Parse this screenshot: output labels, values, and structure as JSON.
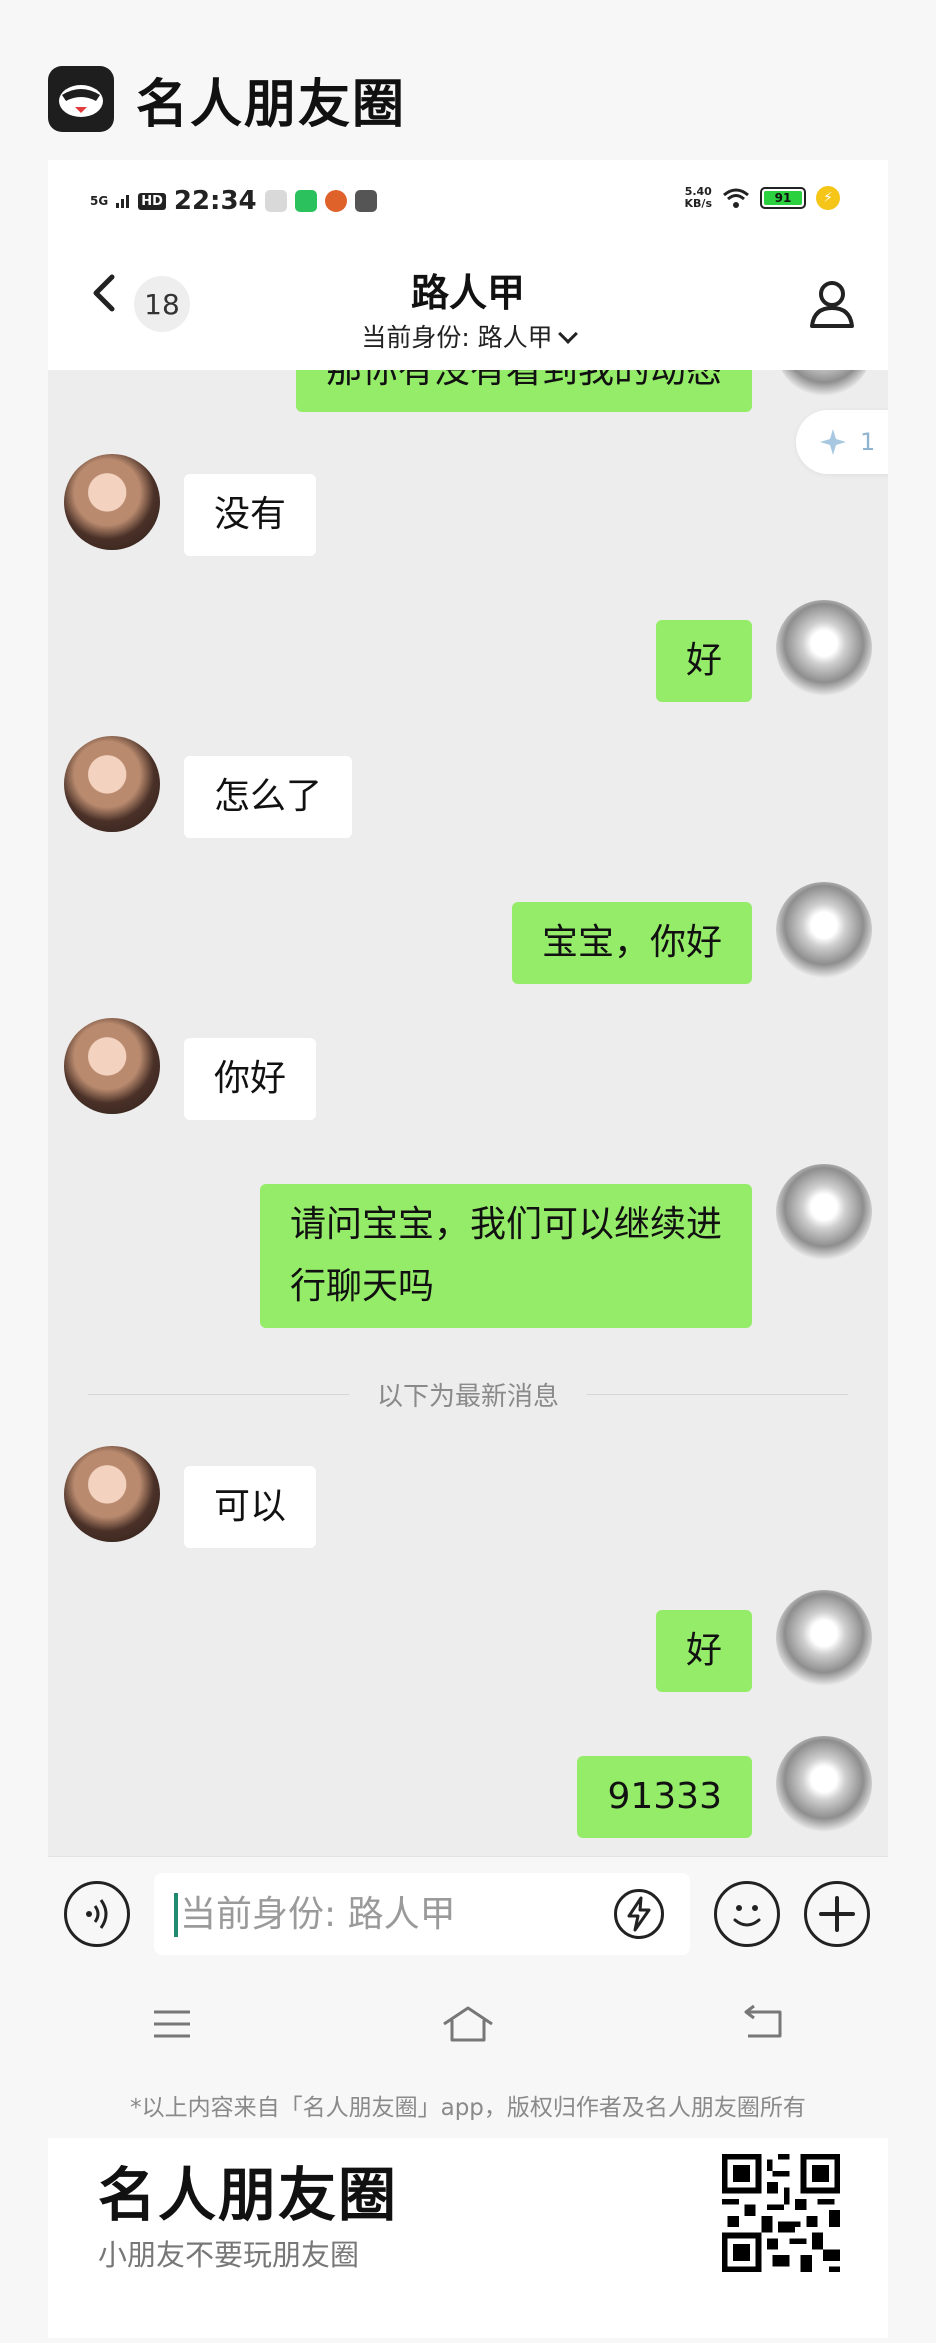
{
  "brand": {
    "title": "名人朋友圈"
  },
  "status_bar": {
    "network": "5G",
    "hd": "HD",
    "time": "22:34",
    "speed_top": "5.40",
    "speed_unit": "KB/s",
    "battery": "91"
  },
  "header": {
    "unread_count": "18",
    "title": "路人甲",
    "identity": "当前身份: 路人甲"
  },
  "float_badge": {
    "count": "1"
  },
  "messages": [
    {
      "side": "right",
      "text": "那你有没有看到我的动态"
    },
    {
      "side": "left",
      "text": "没有"
    },
    {
      "side": "right",
      "text": "好"
    },
    {
      "side": "left",
      "text": "怎么了"
    },
    {
      "side": "right",
      "text": "宝宝，你好"
    },
    {
      "side": "left",
      "text": "你好"
    },
    {
      "side": "right",
      "text_line1": "请问宝宝，我们可以继续进",
      "text_line2": "行聊天吗"
    },
    {
      "side": "left",
      "text": "可以"
    },
    {
      "side": "right",
      "text": "好"
    },
    {
      "side": "right",
      "text": "91333"
    }
  ],
  "divider": {
    "text": "以下为最新消息"
  },
  "input": {
    "placeholder": "当前身份: 路人甲"
  },
  "footer": {
    "note": "*以上内容来自「名人朋友圈」app，版权归作者及名人朋友圈所有",
    "title": "名人朋友圈",
    "subtitle": "小朋友不要玩朋友圈"
  },
  "colors": {
    "sent_bubble": "#95ec69",
    "received_bubble": "#ffffff",
    "chat_bg": "#ededed"
  },
  "icons": [
    "back-chevron-icon",
    "profile-icon",
    "voice-icon",
    "lightning-icon",
    "emoji-icon",
    "plus-icon",
    "menu-icon",
    "home-icon",
    "back-icon",
    "qr-code-icon"
  ]
}
